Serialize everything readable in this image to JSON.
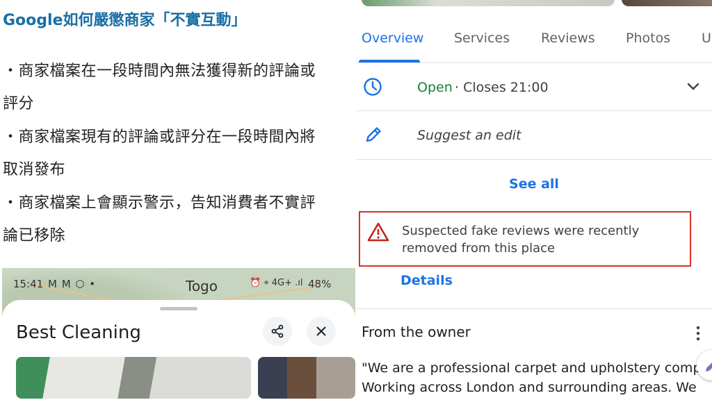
{
  "article": {
    "title": "Google如何嚴懲商家「不實互動」",
    "lines": [
      "・商家檔案在一段時間內無法獲得新的評論或",
      "評分",
      "・商家檔案現有的評論或評分在一段時間內將",
      "取消發布",
      "・商家檔案上會顯示警示，告知消費者不實評",
      "論已移除"
    ]
  },
  "phone": {
    "status_time": "15:41",
    "status_icons_left": "M M ⬡ •",
    "map_label": "Togo",
    "status_icons_right": "⏰ ⌖ 4G+ .ıl",
    "battery": "48%",
    "place_name": "Best Cleaning",
    "icons": {
      "share": "share-icon",
      "close": "close-icon"
    }
  },
  "maps": {
    "tabs": [
      "Overview",
      "Services",
      "Reviews",
      "Photos",
      "U"
    ],
    "active_tab": "Overview",
    "open_status": "Open",
    "hours": "· Closes 21:00",
    "suggest_edit": "Suggest an edit",
    "see_all": "See all",
    "warning": "Suspected fake reviews were recently removed from this place",
    "details": "Details",
    "owner_heading": "From the owner",
    "owner_description_lines": [
      "\"We are a professional carpet and upholstery company",
      "Working across London and surrounding areas. We"
    ],
    "colors": {
      "accent": "#1a73e8",
      "open_green": "#188038",
      "warning_red": "#d93025",
      "title_blue": "#1a6fa3"
    }
  }
}
